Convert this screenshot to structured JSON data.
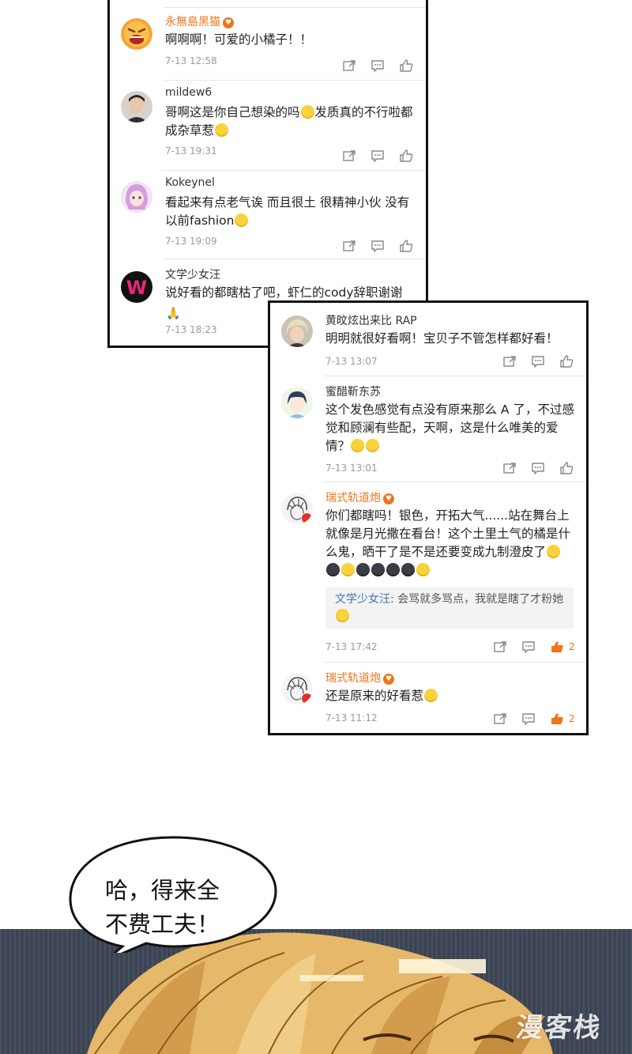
{
  "panel_a": {
    "comments": [
      {
        "user": "永無島黑猫",
        "vip": true,
        "text": "啊啊啊！可爱的小橘子！！",
        "time": "7-13 12:58"
      },
      {
        "user": "mildew6",
        "vip": false,
        "text_parts": [
          "哥啊这是你自己想染的吗",
          "发质真的不行啦都成杂草惹"
        ],
        "time": "7-13 19:31"
      },
      {
        "user": "Kokeynel",
        "vip": false,
        "text": "看起来有点老气诶 而且很土 很精神小伙 没有以前fashion",
        "time": "7-13 19:09"
      },
      {
        "user": "文学少女汪",
        "vip": false,
        "text": "说好看的都瞎枯了吧，虾仁的cody辞职谢谢",
        "time": "7-13 18:23"
      }
    ]
  },
  "panel_b": {
    "comments": [
      {
        "user": "黄旼炫出来比 RAP",
        "vip": false,
        "text": "明明就很好看啊！宝贝子不管怎样都好看！",
        "time": "7-13 13:07"
      },
      {
        "user": "蜜醋靳东苏",
        "vip": false,
        "text": "这个发色感觉有点没有原来那么 A 了，不过感觉和顾澜有些配，天啊，这是什么唯美的爱情？",
        "time": "7-13 13:01"
      },
      {
        "user": "瑞式轨道炮",
        "vip": true,
        "text": "你们都瞎吗！银色，开拓大气......站在舞台上就像是月光撒在看台！这个土里土气的橘是什么鬼，晒干了是不是还要变成九制澄皮了",
        "reply_name": "文学少女汪",
        "reply_text": ": 会骂就多骂点，我就是瞎了才粉她",
        "time": "7-13 17:42",
        "likes": "2"
      },
      {
        "user": "瑞式轨道炮",
        "vip": true,
        "text": "还是原来的好看惹",
        "time": "7-13 11:12",
        "likes": "2"
      }
    ]
  },
  "speech_bubble": {
    "line1": "哈，得来全",
    "line2": "不费工夫！"
  },
  "watermark": "漫客栈",
  "colors": {
    "vip_name": "#f0751a",
    "reply_name": "#3d77b5",
    "liked": "#f0751a",
    "scene_bg": "#3c4452",
    "hair": "#e6b86a"
  }
}
